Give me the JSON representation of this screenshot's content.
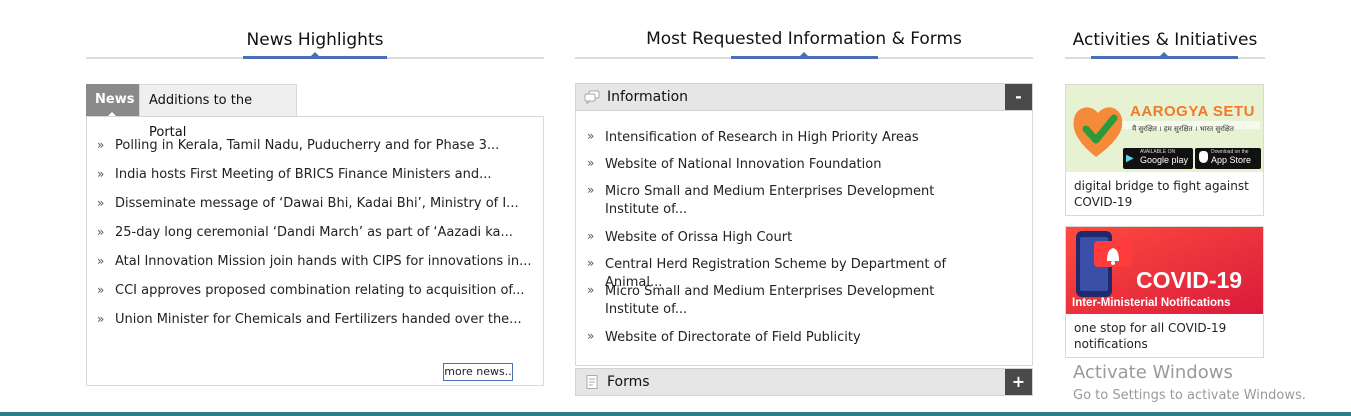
{
  "sections": {
    "news_title": "News Highlights",
    "info_title": "Most Requested Information & Forms",
    "activities_title": "Activities & Initiatives"
  },
  "news": {
    "tabs": [
      "News",
      "Additions to the Portal"
    ],
    "items": [
      "Polling in Kerala, Tamil Nadu, Puducherry and for Phase 3...",
      "India hosts First Meeting of BRICS Finance Ministers and...",
      "Disseminate message of ‘Dawai Bhi, Kadai Bhi’, Ministry of I...",
      "25-day long ceremonial ‘Dandi March’ as part of ‘Aazadi ka...",
      "Atal Innovation Mission join hands with CIPS for innovations in...",
      "CCI approves proposed combination relating to acquisition of...",
      "Union Minister for Chemicals and Fertilizers handed over the..."
    ],
    "more_label": "more news.."
  },
  "information": {
    "header": "Information",
    "toggle": "-",
    "items": [
      "Intensification of Research in High Priority Areas",
      "Website of National Innovation Foundation",
      "Micro Small and Medium Enterprises Development Institute of...",
      "Website of Orissa High Court",
      "Central Herd Registration Scheme by Department of Animal...",
      "Micro Small and Medium Enterprises Development Institute of...",
      "Website of Directorate of Field Publicity"
    ]
  },
  "forms": {
    "header": "Forms",
    "toggle": "+"
  },
  "activities": {
    "cards": [
      {
        "banner_title": "AAROGYA SETU",
        "banner_tagline": "मैं सुरक्षित । हम सुरक्षित । भारत सुरक्षित",
        "store1_small": "AVAILABLE ON",
        "store1": "Google play",
        "store2_small": "Download on the",
        "store2": "App Store",
        "caption": "digital bridge to fight against COVID-19"
      },
      {
        "banner_title": "COVID-19",
        "banner_sub": "Inter-Ministerial Notifications",
        "caption": "one stop for all COVID-19 notifications"
      }
    ]
  },
  "watermark": {
    "line1": "Activate Windows",
    "line2": "Go to Settings to activate Windows."
  },
  "colors": {
    "accent": "#4a6fb5",
    "active_tab": "#8a8a8a",
    "aarogya_green": "#8fcf3e",
    "covid_red": "#e8323c"
  }
}
